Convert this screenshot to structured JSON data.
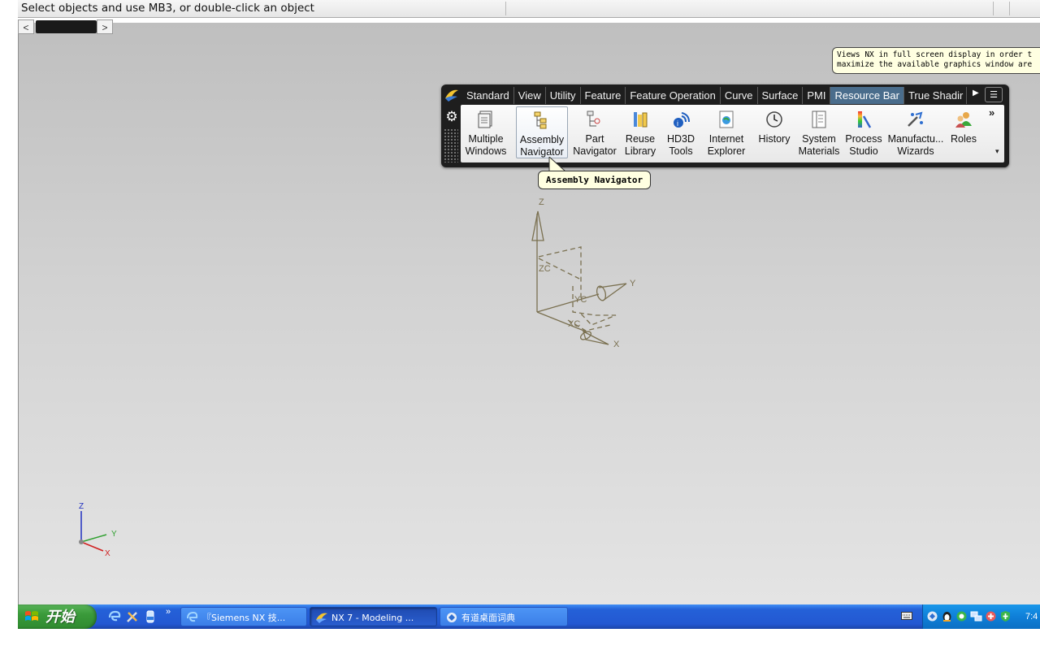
{
  "status_bar": {
    "prompt": "Select objects and use MB3, or double-click an object"
  },
  "scroller": {
    "left": "<",
    "right": ">"
  },
  "tooltip_fullscreen": {
    "line1": "Views NX in full screen display in order t",
    "line2": "maximize the available graphics window are"
  },
  "ribbon": {
    "tabs": [
      {
        "label": "Standard"
      },
      {
        "label": "View"
      },
      {
        "label": "Utility"
      },
      {
        "label": "Feature"
      },
      {
        "label": "Feature Operation"
      },
      {
        "label": "Curve"
      },
      {
        "label": "Surface"
      },
      {
        "label": "PMI"
      },
      {
        "label": "Resource Bar"
      },
      {
        "label": "True Shadir"
      }
    ],
    "active_tab": "Resource Bar",
    "commands": [
      {
        "line1": "Multiple",
        "line2": "Windows"
      },
      {
        "line1": "Assembly",
        "line2": "Navigator"
      },
      {
        "line1": "Part",
        "line2": "Navigator"
      },
      {
        "line1": "Reuse",
        "line2": "Library"
      },
      {
        "line1": "HD3D",
        "line2": "Tools"
      },
      {
        "line1": "Internet",
        "line2": "Explorer"
      },
      {
        "line1": "History",
        "line2": ""
      },
      {
        "line1": "System",
        "line2": "Materials"
      },
      {
        "line1": "Process",
        "line2": "Studio"
      },
      {
        "line1": "Manufactu...",
        "line2": "Wizards"
      },
      {
        "line1": "Roles",
        "line2": ""
      }
    ],
    "chevron": "»"
  },
  "tooltip_assembly": {
    "text": "Assembly Navigator"
  },
  "csys_main": {
    "z": "Z",
    "y": "Y",
    "x": "X",
    "zc": "ZC",
    "yc": "YC",
    "xc": "XC"
  },
  "triad": {
    "z": "Z",
    "y": "Y",
    "x": "X"
  },
  "taskbar": {
    "start_label": "开始",
    "quicklaunch_more": "»",
    "tasks": [
      {
        "label": "『Siemens NX 技..."
      },
      {
        "label": "NX 7 - Modeling ..."
      },
      {
        "label": "有道桌面词典"
      }
    ],
    "clock": "7:4"
  },
  "colors": {
    "accent_tab": "#4a6d8c",
    "wcs_lines": "#7a7050",
    "taskbar_blue": "#2461d8"
  }
}
